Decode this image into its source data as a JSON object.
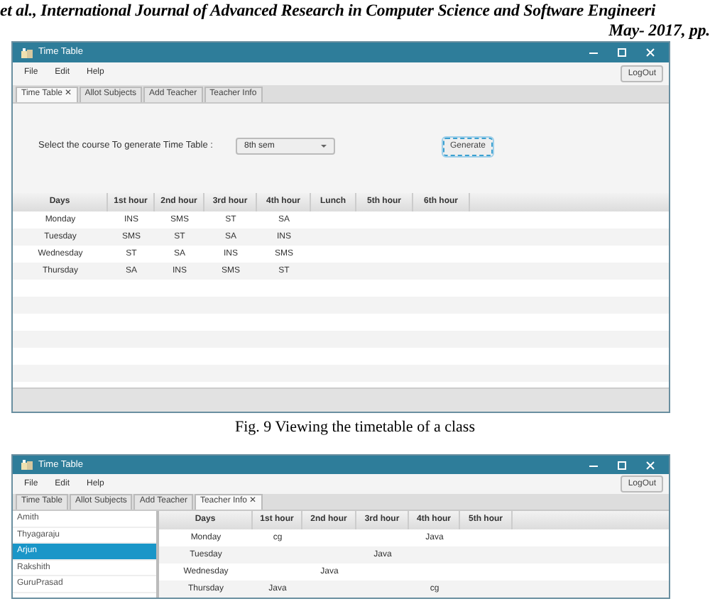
{
  "running_header": {
    "line_1": "et al., International Journal of Advanced Research in Computer Science and Software Engineeri",
    "line_2": "May- 2017, pp."
  },
  "window_1": {
    "title": "Time Table",
    "menu": [
      "File",
      "Edit",
      "Help"
    ],
    "logout": "LogOut",
    "tab_close_glyph": "✕",
    "tabs": [
      {
        "label": "Time Table",
        "selected": true
      },
      {
        "label": "Allot Subjects",
        "selected": false
      },
      {
        "label": "Add Teacher",
        "selected": false
      },
      {
        "label": "Teacher Info",
        "selected": false
      }
    ],
    "course_label": "Select the course To generate Time Table :",
    "course_value": "8th sem",
    "generate": "Generate",
    "table": {
      "columns": [
        "Days",
        "1st hour",
        "2nd hour",
        "3rd hour",
        "4th hour",
        "Lunch",
        "5th hour",
        "6th hour"
      ],
      "rows": [
        [
          "Monday",
          "INS",
          "SMS",
          "ST",
          "SA",
          null,
          null,
          null
        ],
        [
          "Tuesday",
          "SMS",
          "ST",
          "SA",
          "INS",
          null,
          null,
          null
        ],
        [
          "Wednesday",
          "ST",
          "SA",
          "INS",
          "SMS",
          null,
          null,
          null
        ],
        [
          "Thursday",
          "SA",
          "INS",
          "SMS",
          "ST",
          null,
          null,
          null
        ]
      ]
    }
  },
  "caption": "Fig. 9 Viewing the timetable of a class",
  "window_2": {
    "title": "Time Table",
    "menu": [
      "File",
      "Edit",
      "Help"
    ],
    "logout": "LogOut",
    "tab_close_glyph": "✕",
    "tabs": [
      {
        "label": "Time Table",
        "selected": false
      },
      {
        "label": "Allot Subjects",
        "selected": false
      },
      {
        "label": "Add Teacher",
        "selected": false
      },
      {
        "label": "Teacher Info",
        "selected": true
      }
    ],
    "teachers": [
      {
        "name": "Amith",
        "selected": false
      },
      {
        "name": "Thyagaraju",
        "selected": false
      },
      {
        "name": "Arjun",
        "selected": true
      },
      {
        "name": "Rakshith",
        "selected": false
      },
      {
        "name": "GuruPrasad",
        "selected": false
      }
    ],
    "table": {
      "columns": [
        "Days",
        "1st hour",
        "2nd hour",
        "3rd hour",
        "4th hour",
        "5th hour"
      ],
      "rows": [
        [
          "Monday",
          "cg",
          null,
          null,
          "Java",
          null
        ],
        [
          "Tuesday",
          null,
          null,
          "Java",
          null,
          null
        ],
        [
          "Wednesday",
          null,
          "Java",
          null,
          null,
          null
        ],
        [
          "Thursday",
          "Java",
          null,
          null,
          "cg",
          null
        ]
      ]
    }
  }
}
